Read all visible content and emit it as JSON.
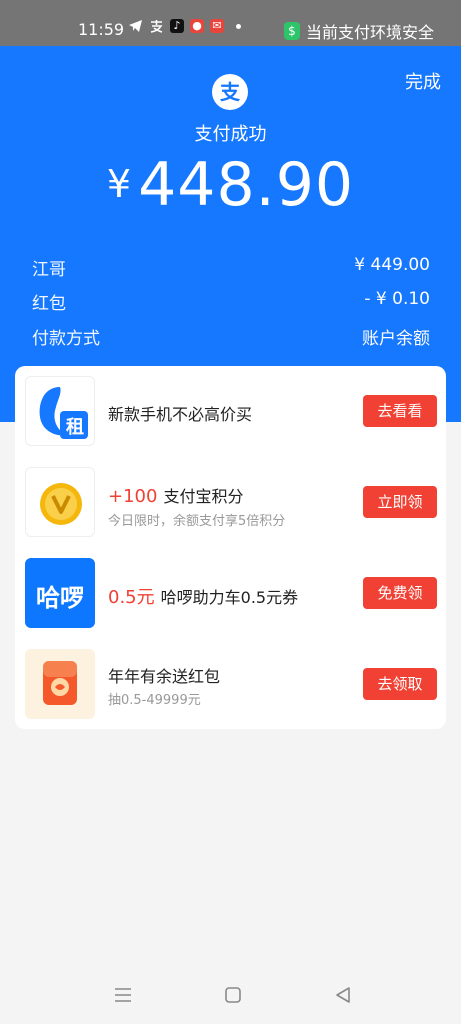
{
  "status_bar": {
    "time": "11:59",
    "safe_text": "当前支付环境安全",
    "safe_icon_glyph": "$"
  },
  "header": {
    "done_label": "完成",
    "logo_glyph": "支",
    "title": "支付成功",
    "currency": "¥",
    "amount": "448.90"
  },
  "details": [
    {
      "label": "江哥",
      "value": "¥ 449.00"
    },
    {
      "label": "红包",
      "value": "- ¥ 0.10"
    },
    {
      "label": "付款方式",
      "value": "账户余额"
    }
  ],
  "promos": [
    {
      "icon": "zu-rent-icon",
      "icon_text": "租",
      "highlight": "",
      "title": "新款手机不必高价买",
      "subtitle": "",
      "button": "去看看"
    },
    {
      "icon": "v-coin-icon",
      "icon_text": "V",
      "highlight": "+100",
      "title": "支付宝积分",
      "subtitle": "今日限时，余额支付享5倍积分",
      "button": "立即领"
    },
    {
      "icon": "hellobike-icon",
      "icon_text": "哈啰",
      "highlight": "0.5元",
      "title": "哈啰助力车0.5元券",
      "subtitle": "",
      "button": "免费领"
    },
    {
      "icon": "red-envelope-icon",
      "icon_text": "",
      "highlight": "",
      "title": "年年有余送红包",
      "subtitle": "抽0.5-49999元",
      "button": "去领取"
    }
  ],
  "colors": {
    "brand_blue": "#1677ff",
    "accent_red": "#f04134",
    "status_bar": "#757575"
  }
}
